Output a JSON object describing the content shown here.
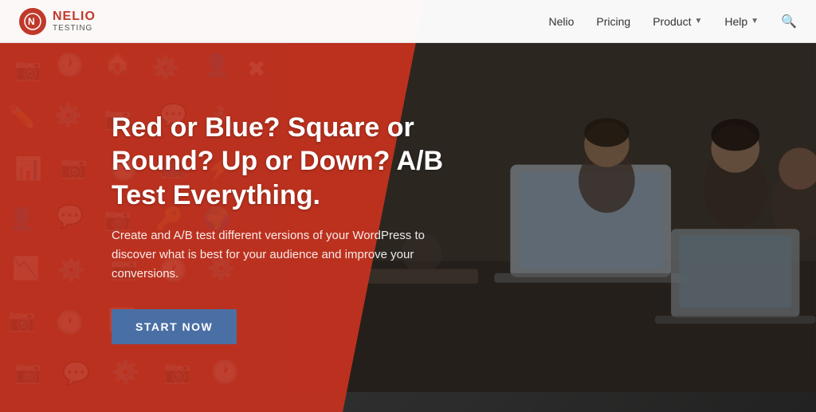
{
  "brand": {
    "name_top": "NELIO",
    "name_bottom": "testing",
    "logo_letter": "N"
  },
  "navbar": {
    "links": [
      {
        "label": "Nelio",
        "has_dropdown": false
      },
      {
        "label": "Pricing",
        "has_dropdown": false
      },
      {
        "label": "Product",
        "has_dropdown": true
      },
      {
        "label": "Help",
        "has_dropdown": true
      }
    ]
  },
  "hero": {
    "headline": "Red or Blue? Square or Round? Up or Down? A/B Test Everything.",
    "subtext": "Create and A/B test different versions of your WordPress to discover what is best for your audience and improve your conversions.",
    "cta_label": "START NOW"
  },
  "colors": {
    "red_accent": "#c0392b",
    "blue_cta": "#4a6fa5",
    "dark_overlay": "rgba(20,20,20,0.55)"
  }
}
